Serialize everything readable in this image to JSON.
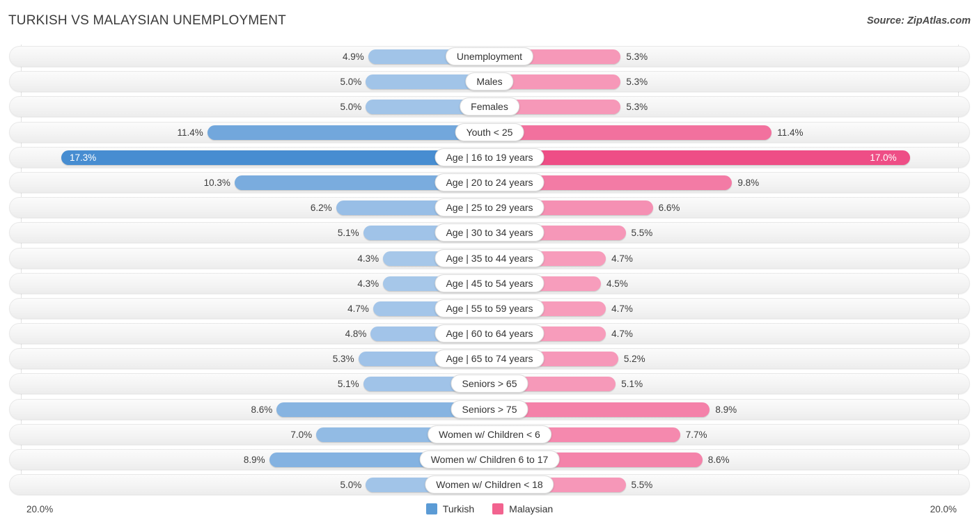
{
  "header": {
    "title": "TURKISH VS MALAYSIAN UNEMPLOYMENT",
    "source": "Source: ZipAtlas.com"
  },
  "axis": {
    "left_label": "20.0%",
    "right_label": "20.0%",
    "max": 20.0
  },
  "legend": {
    "items": [
      {
        "label": "Turkish",
        "color": "#5b9bd5"
      },
      {
        "label": "Malaysian",
        "color": "#f2638f"
      }
    ]
  },
  "chart_data": {
    "type": "bar",
    "orientation": "horizontal-diverging",
    "title": "TURKISH VS MALAYSIAN UNEMPLOYMENT",
    "xlabel": "",
    "ylabel": "",
    "xlim": [
      20.0,
      20.0
    ],
    "grid": true,
    "legend_position": "bottom-center",
    "categories": [
      "Unemployment",
      "Males",
      "Females",
      "Youth < 25",
      "Age | 16 to 19 years",
      "Age | 20 to 24 years",
      "Age | 25 to 29 years",
      "Age | 30 to 34 years",
      "Age | 35 to 44 years",
      "Age | 45 to 54 years",
      "Age | 55 to 59 years",
      "Age | 60 to 64 years",
      "Age | 65 to 74 years",
      "Seniors > 65",
      "Seniors > 75",
      "Women w/ Children < 6",
      "Women w/ Children 6 to 17",
      "Women w/ Children < 18"
    ],
    "series": [
      {
        "name": "Turkish",
        "color": "#5b9bd5",
        "values": [
          4.9,
          5.0,
          5.0,
          11.4,
          17.3,
          10.3,
          6.2,
          5.1,
          4.3,
          4.3,
          4.7,
          4.8,
          5.3,
          5.1,
          8.6,
          7.0,
          8.9,
          5.0
        ],
        "labels": [
          "4.9%",
          "5.0%",
          "5.0%",
          "11.4%",
          "17.3%",
          "10.3%",
          "6.2%",
          "5.1%",
          "4.3%",
          "4.3%",
          "4.7%",
          "4.8%",
          "5.3%",
          "5.1%",
          "8.6%",
          "7.0%",
          "8.9%",
          "5.0%"
        ]
      },
      {
        "name": "Malaysian",
        "color": "#f2638f",
        "values": [
          5.3,
          5.3,
          5.3,
          11.4,
          17.0,
          9.8,
          6.6,
          5.5,
          4.7,
          4.5,
          4.7,
          4.7,
          5.2,
          5.1,
          8.9,
          7.7,
          8.6,
          5.5
        ],
        "labels": [
          "5.3%",
          "5.3%",
          "5.3%",
          "11.4%",
          "17.0%",
          "9.8%",
          "6.6%",
          "5.5%",
          "4.7%",
          "4.5%",
          "4.7%",
          "4.7%",
          "5.2%",
          "5.1%",
          "8.9%",
          "7.7%",
          "8.6%",
          "5.5%"
        ]
      }
    ]
  }
}
